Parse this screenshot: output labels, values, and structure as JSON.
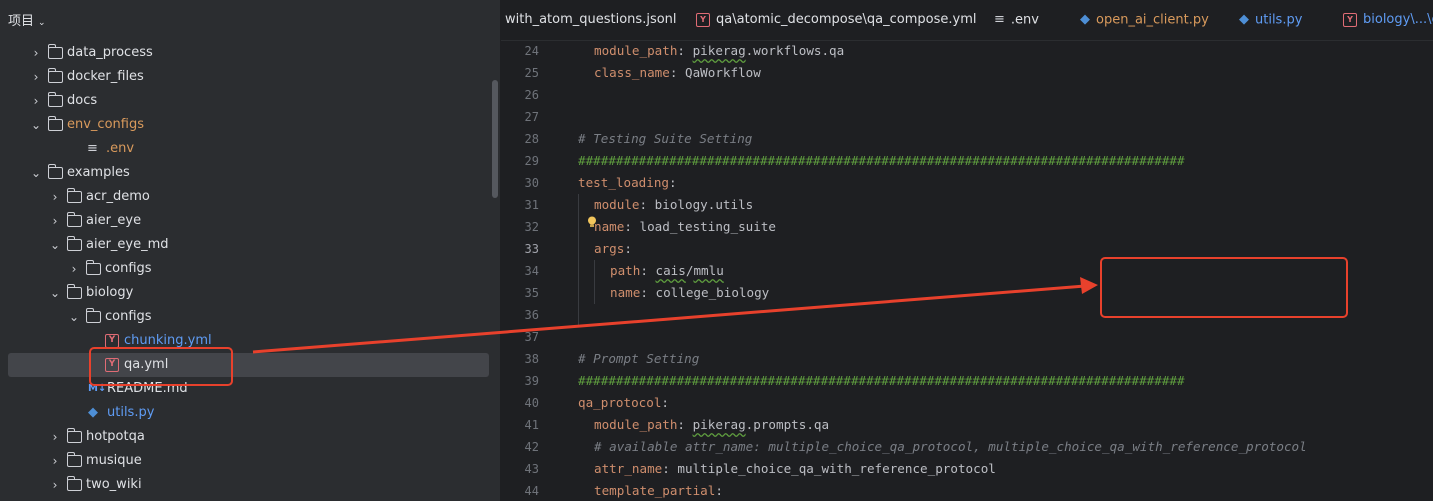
{
  "sidebar": {
    "title": "项目",
    "items": [
      {
        "label": "data_process",
        "type": "folder",
        "indent": 1,
        "expandable": true,
        "expanded": false,
        "color": "#dfe1e5"
      },
      {
        "label": "docker_files",
        "type": "folder",
        "indent": 1,
        "expandable": true,
        "expanded": false,
        "color": "#dfe1e5"
      },
      {
        "label": "docs",
        "type": "folder",
        "indent": 1,
        "expandable": true,
        "expanded": false,
        "color": "#dfe1e5"
      },
      {
        "label": "env_configs",
        "type": "folder",
        "indent": 1,
        "expandable": true,
        "expanded": true,
        "color": "#d99a5c"
      },
      {
        "label": ".env",
        "type": "env",
        "indent": 2,
        "expandable": false,
        "color": "#d99a5c"
      },
      {
        "label": "examples",
        "type": "folder",
        "indent": 1,
        "expandable": true,
        "expanded": true,
        "color": "#dfe1e5"
      },
      {
        "label": "acr_demo",
        "type": "folder",
        "indent": 2,
        "expandable": true,
        "expanded": false,
        "color": "#dfe1e5"
      },
      {
        "label": "aier_eye",
        "type": "folder",
        "indent": 2,
        "expandable": true,
        "expanded": false,
        "color": "#dfe1e5"
      },
      {
        "label": "aier_eye_md",
        "type": "folder",
        "indent": 2,
        "expandable": true,
        "expanded": true,
        "color": "#dfe1e5"
      },
      {
        "label": "configs",
        "type": "folder",
        "indent": 3,
        "expandable": true,
        "expanded": false,
        "color": "#dfe1e5"
      },
      {
        "label": "biology",
        "type": "folder",
        "indent": 2,
        "expandable": true,
        "expanded": true,
        "color": "#dfe1e5"
      },
      {
        "label": "configs",
        "type": "folder",
        "indent": 3,
        "expandable": true,
        "expanded": true,
        "color": "#dfe1e5"
      },
      {
        "label": "chunking.yml",
        "type": "yml",
        "indent": 4,
        "expandable": false,
        "color": "#5f9cf4"
      },
      {
        "label": "qa.yml",
        "type": "yml",
        "indent": 4,
        "expandable": false,
        "color": "#dfe1e5",
        "selected": true
      },
      {
        "label": "README.md",
        "type": "md",
        "indent": 3,
        "expandable": false,
        "color": "#dfe1e5"
      },
      {
        "label": "utils.py",
        "type": "py",
        "indent": 3,
        "expandable": false,
        "color": "#5f9cf4"
      },
      {
        "label": "hotpotqa",
        "type": "folder",
        "indent": 2,
        "expandable": true,
        "expanded": false,
        "color": "#dfe1e5"
      },
      {
        "label": "musique",
        "type": "folder",
        "indent": 2,
        "expandable": true,
        "expanded": false,
        "color": "#dfe1e5"
      },
      {
        "label": "two_wiki",
        "type": "folder",
        "indent": 2,
        "expandable": true,
        "expanded": false,
        "color": "#dfe1e5"
      }
    ]
  },
  "tabs": [
    {
      "label": "with_atom_questions.jsonl",
      "icon": "none",
      "color": "#dfe1e5"
    },
    {
      "label": "qa\\atomic_decompose\\qa_compose.yml",
      "icon": "yml",
      "color": "#dfe1e5"
    },
    {
      "label": ".env",
      "icon": "env",
      "color": "#dfe1e5"
    },
    {
      "label": "open_ai_client.py",
      "icon": "py",
      "color": "#d99a5c"
    },
    {
      "label": "utils.py",
      "icon": "py",
      "color": "#5f9cf4"
    },
    {
      "label": "biology\\...\\c",
      "icon": "yml",
      "color": "#5f9cf4"
    }
  ],
  "editor": {
    "current_line": 33,
    "lines": [
      {
        "n": 24,
        "indent": 1,
        "parts": [
          {
            "t": "key",
            "v": "module_path"
          },
          {
            "t": "plain",
            "v": ": "
          },
          {
            "t": "wavy",
            "v": "pikerag"
          },
          {
            "t": "plain",
            "v": ".workflows.qa"
          }
        ]
      },
      {
        "n": 25,
        "indent": 1,
        "parts": [
          {
            "t": "key",
            "v": "class_name"
          },
          {
            "t": "plain",
            "v": ": QaWorkflow"
          }
        ]
      },
      {
        "n": 26,
        "indent": 0,
        "parts": []
      },
      {
        "n": 27,
        "indent": 0,
        "parts": []
      },
      {
        "n": 28,
        "indent": 0,
        "parts": [
          {
            "t": "comment",
            "v": "# Testing Suite Setting"
          }
        ]
      },
      {
        "n": 29,
        "indent": 0,
        "parts": [
          {
            "t": "hash",
            "v": "################################################################################"
          }
        ]
      },
      {
        "n": 30,
        "indent": 0,
        "parts": [
          {
            "t": "key",
            "v": "test_loading"
          },
          {
            "t": "plain",
            "v": ":"
          }
        ]
      },
      {
        "n": 31,
        "indent": 1,
        "parts": [
          {
            "t": "key",
            "v": "module"
          },
          {
            "t": "plain",
            "v": ": biology.utils"
          }
        ]
      },
      {
        "n": 32,
        "indent": 1,
        "parts": [
          {
            "t": "key",
            "v": "name"
          },
          {
            "t": "plain",
            "v": ": load_testing_suite"
          }
        ]
      },
      {
        "n": 33,
        "indent": 1,
        "parts": [
          {
            "t": "key",
            "v": "args"
          },
          {
            "t": "plain",
            "v": ":"
          }
        ]
      },
      {
        "n": 34,
        "indent": 2,
        "parts": [
          {
            "t": "key",
            "v": "path"
          },
          {
            "t": "plain",
            "v": ": "
          },
          {
            "t": "wavy",
            "v": "cais"
          },
          {
            "t": "plain",
            "v": "/"
          },
          {
            "t": "wavy",
            "v": "mmlu"
          }
        ]
      },
      {
        "n": 35,
        "indent": 2,
        "parts": [
          {
            "t": "key",
            "v": "name"
          },
          {
            "t": "plain",
            "v": ": college_biology"
          }
        ]
      },
      {
        "n": 36,
        "indent": 0,
        "parts": []
      },
      {
        "n": 37,
        "indent": 0,
        "parts": []
      },
      {
        "n": 38,
        "indent": 0,
        "parts": [
          {
            "t": "comment",
            "v": "# Prompt Setting"
          }
        ]
      },
      {
        "n": 39,
        "indent": 0,
        "parts": [
          {
            "t": "hash",
            "v": "################################################################################"
          }
        ]
      },
      {
        "n": 40,
        "indent": 0,
        "parts": [
          {
            "t": "key",
            "v": "qa_protocol"
          },
          {
            "t": "plain",
            "v": ":"
          }
        ]
      },
      {
        "n": 41,
        "indent": 1,
        "parts": [
          {
            "t": "key",
            "v": "module_path"
          },
          {
            "t": "plain",
            "v": ": "
          },
          {
            "t": "wavy",
            "v": "pikerag"
          },
          {
            "t": "plain",
            "v": ".prompts.qa"
          }
        ]
      },
      {
        "n": 42,
        "indent": 1,
        "parts": [
          {
            "t": "comment",
            "v": "# available attr_name: multiple_choice_qa_protocol, multiple_choice_qa_with_reference_protocol"
          }
        ]
      },
      {
        "n": 43,
        "indent": 1,
        "parts": [
          {
            "t": "key",
            "v": "attr_name"
          },
          {
            "t": "plain",
            "v": ": multiple_choice_qa_with_reference_protocol"
          }
        ]
      },
      {
        "n": 44,
        "indent": 1,
        "parts": [
          {
            "t": "key",
            "v": "template_partial"
          },
          {
            "t": "plain",
            "v": ":"
          }
        ]
      }
    ]
  },
  "annotation": {
    "color": "#e8412c"
  }
}
